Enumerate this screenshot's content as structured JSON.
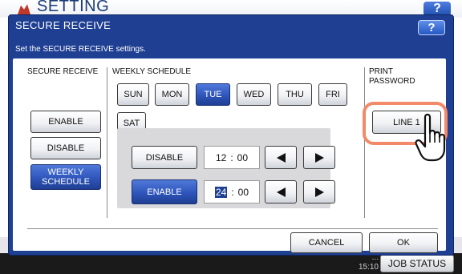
{
  "app": {
    "title": "SETTING",
    "help_label": "?"
  },
  "dialog": {
    "title": "SECURE RECEIVE",
    "help_label": "?",
    "message": "Set the SECURE RECEIVE settings."
  },
  "secure_receive": {
    "label": "SECURE RECEIVE",
    "options": {
      "enable": "ENABLE",
      "disable": "DISABLE",
      "weekly": "WEEKLY SCHEDULE"
    },
    "selected": "WEEKLY SCHEDULE"
  },
  "weekly_schedule": {
    "label": "WEEKLY SCHEDULE",
    "days": [
      "SUN",
      "MON",
      "TUE",
      "WED",
      "THU",
      "FRI",
      "SAT"
    ],
    "selected_day": "TUE",
    "disable_row": {
      "label": "DISABLE",
      "hour": "12",
      "sep": ":",
      "minute": "00"
    },
    "enable_row": {
      "label": "ENABLE",
      "hour": "24",
      "sep": ":",
      "minute": "00"
    }
  },
  "print_password": {
    "label": "PRINT PASSWORD",
    "line_button": "LINE 1"
  },
  "actions": {
    "cancel": "CANCEL",
    "ok": "OK"
  },
  "status_bar": {
    "date": "...",
    "time": "15:10",
    "job_status": "JOB STATUS"
  },
  "colors": {
    "dialog_blue": "#1f3f92",
    "selected_button": "#2f55bb",
    "highlight_ring": "#f28a6a"
  }
}
